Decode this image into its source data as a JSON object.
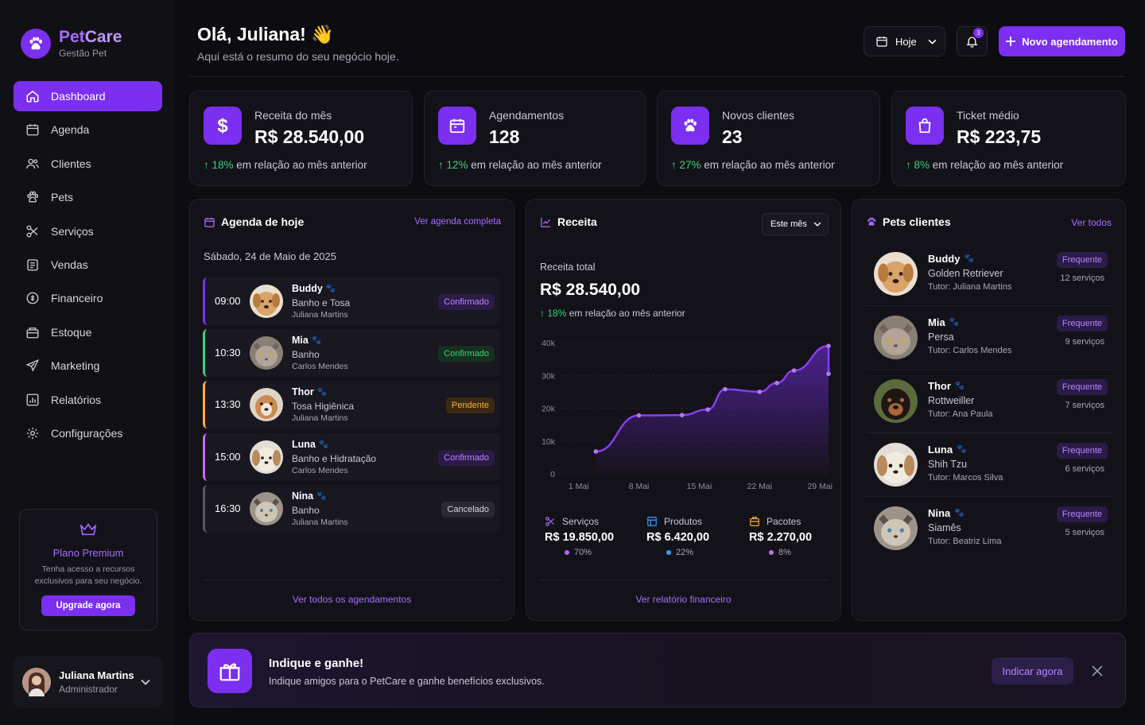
{
  "brand": {
    "name_part1": "Pet",
    "name_part2": "Care",
    "subtitle": "Gestão Pet"
  },
  "nav": [
    {
      "label": "Dashboard",
      "icon": "home-icon",
      "active": true
    },
    {
      "label": "Agenda",
      "icon": "calendar-icon"
    },
    {
      "label": "Clientes",
      "icon": "users-icon"
    },
    {
      "label": "Pets",
      "icon": "paw-icon"
    },
    {
      "label": "Serviços",
      "icon": "services-icon"
    },
    {
      "label": "Vendas",
      "icon": "cart-icon"
    },
    {
      "label": "Financeiro",
      "icon": "dollar-icon"
    },
    {
      "label": "Estoque",
      "icon": "box-icon"
    },
    {
      "label": "Marketing",
      "icon": "megaphone-icon"
    },
    {
      "label": "Relatórios",
      "icon": "report-icon"
    },
    {
      "label": "Configurações",
      "icon": "gear-icon"
    }
  ],
  "premium": {
    "title": "Plano Premium",
    "text": "Tenha acesso a recursos exclusivos para seu negócio.",
    "button": "Upgrade agora"
  },
  "user": {
    "name": "Juliana Martins",
    "role": "Administrador"
  },
  "header": {
    "greeting": "Olá, Juliana! 👋",
    "subtitle": "Aqui está o resumo do seu negócio hoje.",
    "date_filter": "Hoje",
    "notifications": "3",
    "new_button": "Novo agendamento"
  },
  "stats": [
    {
      "label": "Receita do mês",
      "value": "R$ 28.540,00",
      "pct": "18%",
      "delta_text": " em relação ao mês anterior",
      "icon": "dollar-icon"
    },
    {
      "label": "Agendamentos",
      "value": "128",
      "pct": "12%",
      "delta_text": " em relação ao mês anterior",
      "icon": "calendar-icon"
    },
    {
      "label": "Novos clientes",
      "value": "23",
      "pct": "27%",
      "delta_text": " em relação ao mês anterior",
      "icon": "paw-icon"
    },
    {
      "label": "Ticket médio",
      "value": "R$ 223,75",
      "pct": "8%",
      "delta_text": " em relação ao mês anterior",
      "icon": "bag-icon"
    }
  ],
  "agenda": {
    "title": "Agenda de hoje",
    "link": "Ver agenda completa",
    "date": "Sábado, 24 de Maio de 2025",
    "items": [
      {
        "time": "09:00",
        "pet": "Buddy",
        "service": "Banho e Tosa",
        "tutor": "Juliana Martins",
        "status": "Confirmado",
        "accent": "#7b2ff0"
      },
      {
        "time": "10:30",
        "pet": "Mia",
        "service": "Banho",
        "tutor": "Carlos Mendes",
        "status": "Confirmado",
        "accent": "#37d17d"
      },
      {
        "time": "13:30",
        "pet": "Thor",
        "service": "Tosa Higiênica",
        "tutor": "Juliana Martins",
        "status": "Pendente",
        "accent": "#f4b13a"
      },
      {
        "time": "15:00",
        "pet": "Luna",
        "service": "Banho e Hidratação",
        "tutor": "Carlos Mendes",
        "status": "Confirmado",
        "accent": "#c56cf0"
      },
      {
        "time": "16:30",
        "pet": "Nina",
        "service": "Banho",
        "tutor": "Juliana Martins",
        "status": "Cancelado",
        "accent": "#5a5766"
      }
    ],
    "footer_link": "Ver todos os agendamentos"
  },
  "revenue": {
    "title": "Receita",
    "period": "Este mês",
    "total_label": "Receita total",
    "total_value": "R$ 28.540,00",
    "pct": "18%",
    "delta_text": " em relação ao mês anterior",
    "breakdown": [
      {
        "label": "Serviços",
        "value": "R$ 19.850,00",
        "pct": "70%",
        "color": "#a66cff",
        "icon": "scissors-icon"
      },
      {
        "label": "Produtos",
        "value": "R$ 6.420,00",
        "pct": "22%",
        "color": "#3b9cff",
        "icon": "product-icon"
      },
      {
        "label": "Pacotes",
        "value": "R$ 2.270,00",
        "pct": "8%",
        "color": "#c56cf0",
        "icon": "package-icon"
      }
    ],
    "footer_link": "Ver relatório financeiro"
  },
  "chart_data": {
    "type": "area",
    "x_ticks": [
      "1 Mai",
      "8 Mai",
      "15 Mai",
      "22 Mai",
      "29 Mai"
    ],
    "y_ticks": [
      "0",
      "10k",
      "20k",
      "30k",
      "40k"
    ],
    "ylim": [
      0,
      40000
    ],
    "xlim": [
      -1,
      30
    ],
    "points": [
      [
        3,
        6800
      ],
      [
        8,
        17800
      ],
      [
        13,
        17900
      ],
      [
        16,
        19600
      ],
      [
        18,
        25800
      ],
      [
        22,
        25000
      ],
      [
        24,
        27700
      ],
      [
        26,
        31500
      ],
      [
        31,
        39000
      ],
      [
        37,
        30500
      ]
    ],
    "line_color": "#8b3ff5"
  },
  "pets": {
    "title": "Pets clientes",
    "link": "Ver todos",
    "items": [
      {
        "name": "Buddy",
        "breed": "Golden Retriever",
        "tutor": "Tutor: Juliana Martins",
        "badge": "Frequente",
        "count": "12 serviços"
      },
      {
        "name": "Mia",
        "breed": "Persa",
        "tutor": "Tutor: Carlos Mendes",
        "badge": "Frequente",
        "count": "9 serviços"
      },
      {
        "name": "Thor",
        "breed": "Rottweiller",
        "tutor": "Tutor: Ana Paula",
        "badge": "Frequente",
        "count": "7 serviços"
      },
      {
        "name": "Luna",
        "breed": "Shih Tzu",
        "tutor": "Tutor: Marcos Silva",
        "badge": "Frequente",
        "count": "6 serviços"
      },
      {
        "name": "Nina",
        "breed": "Siamês",
        "tutor": "Tutor: Beatriz Lima",
        "badge": "Frequente",
        "count": "5 serviços"
      }
    ]
  },
  "promo": {
    "title": "Indique e ganhe!",
    "text": "Indique amigos para o PetCare e ganhe benefícios exclusivos.",
    "button": "Indicar agora"
  }
}
